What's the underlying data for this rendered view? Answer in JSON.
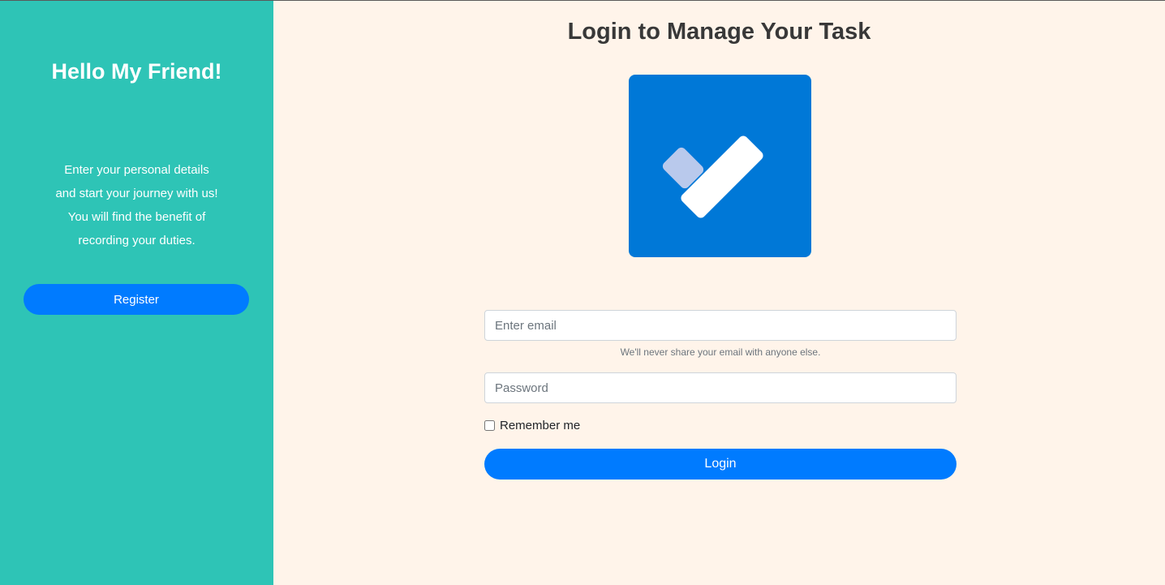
{
  "sidebar": {
    "title": "Hello My Friend!",
    "description_lines": [
      "Enter your personal details",
      "and start your journey with us!",
      "You will find the benefit of",
      "recording your duties."
    ],
    "register_label": "Register"
  },
  "main": {
    "title": "Login to Manage Your Task",
    "logo_icon": "checkmark-icon",
    "email": {
      "placeholder": "Enter email",
      "value": "",
      "help_text": "We'll never share your email with anyone else."
    },
    "password": {
      "placeholder": "Password",
      "value": ""
    },
    "remember_label": "Remember me",
    "remember_checked": false,
    "login_label": "Login"
  },
  "colors": {
    "sidebar_bg": "#2ec4b6",
    "main_bg": "#fff4ea",
    "button_blue": "#007bff",
    "logo_blue": "#0078d7"
  }
}
